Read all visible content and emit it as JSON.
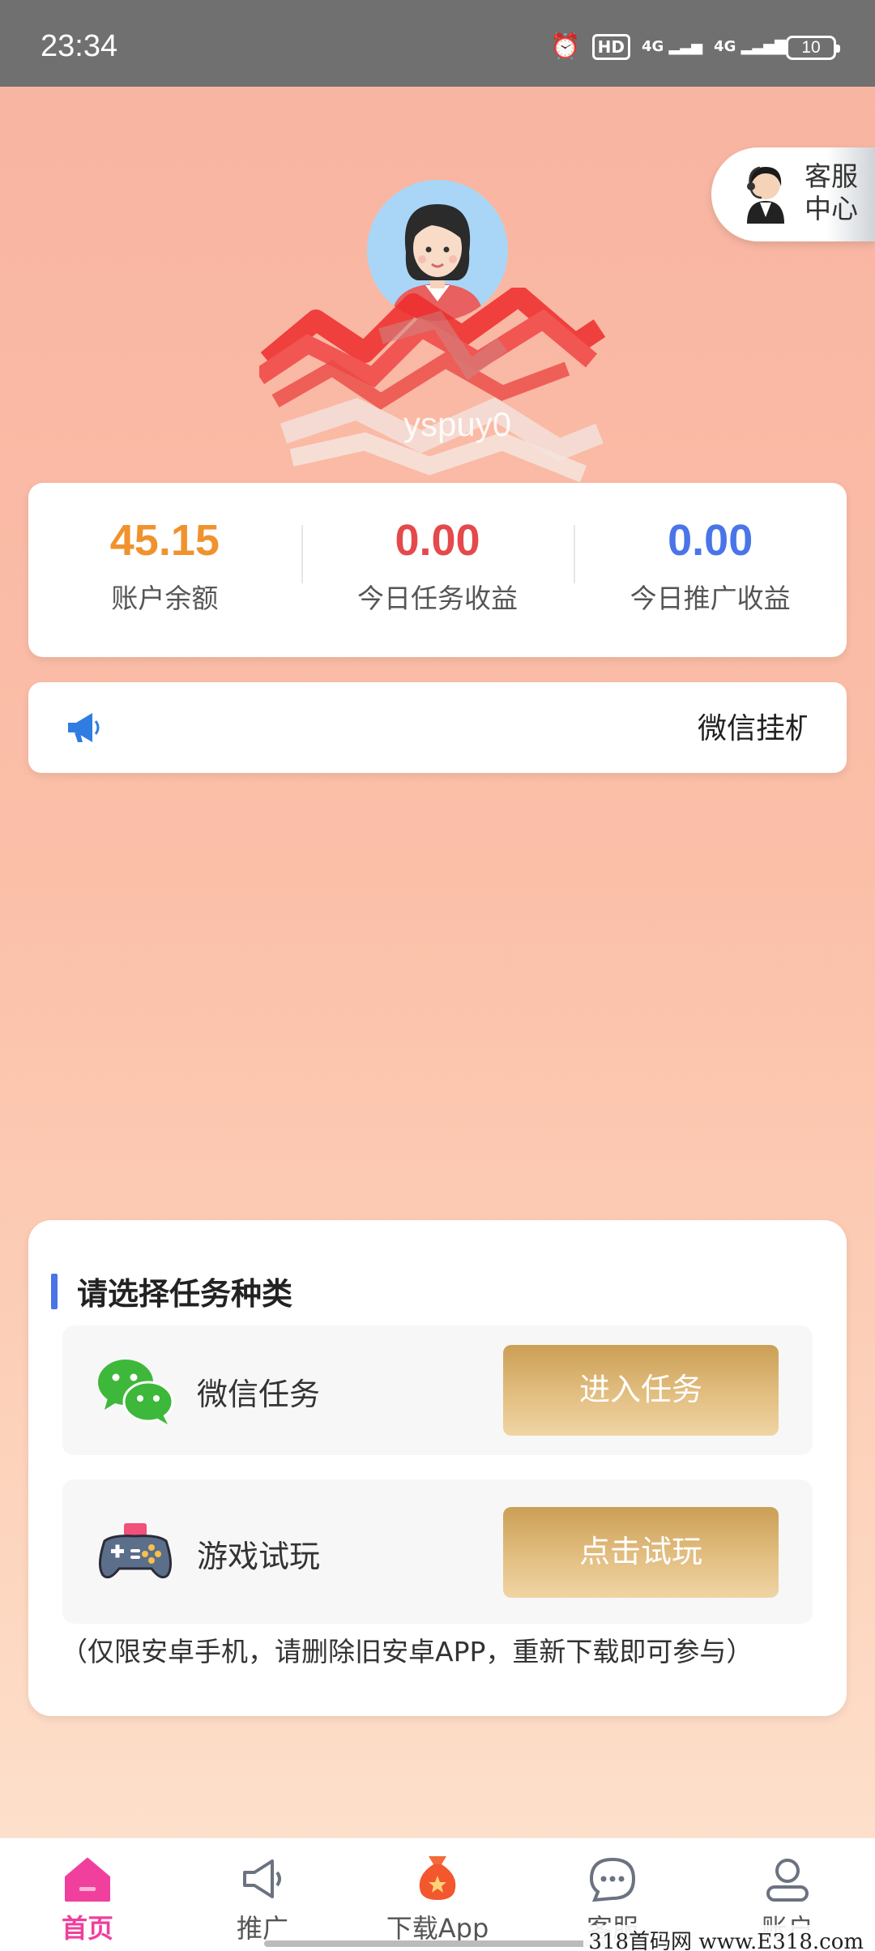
{
  "status_bar": {
    "time": "23:34",
    "hd_label": "HD",
    "net1": "4G",
    "net2": "4G",
    "battery": "10"
  },
  "customer_service_float": {
    "line1": "客服",
    "line2": "中心"
  },
  "profile": {
    "username": "yspuy0"
  },
  "stats": [
    {
      "value": "45.15",
      "label": "账户余额",
      "color": "#f0922d"
    },
    {
      "value": "0.00",
      "label": "今日任务收益",
      "color": "#e5494b"
    },
    {
      "value": "0.00",
      "label": "今日推广收益",
      "color": "#4a74e8"
    }
  ],
  "notice": {
    "text": "微信挂机",
    "icon": "megaphone-icon"
  },
  "task_section": {
    "title": "请选择任务种类",
    "rows": [
      {
        "label": "微信任务",
        "button": "进入任务",
        "icon": "wechat-icon"
      },
      {
        "label": "游戏试玩",
        "button": "点击试玩",
        "icon": "gamepad-icon"
      }
    ],
    "note": "（仅限安卓手机，请删除旧安卓APP，重新下载即可参与）"
  },
  "bottom_nav": [
    {
      "label": "首页",
      "icon": "home-icon",
      "active": true
    },
    {
      "label": "推广",
      "icon": "megaphone-icon"
    },
    {
      "label": "下载App",
      "icon": "money-bag-icon"
    },
    {
      "label": "客服",
      "icon": "chat-icon"
    },
    {
      "label": "账户",
      "icon": "user-icon"
    }
  ],
  "watermark": "318首码网 www.E318.com",
  "colors": {
    "accent": "#f03f9c",
    "gold": "#d9b06b",
    "blue": "#4a74e8"
  }
}
